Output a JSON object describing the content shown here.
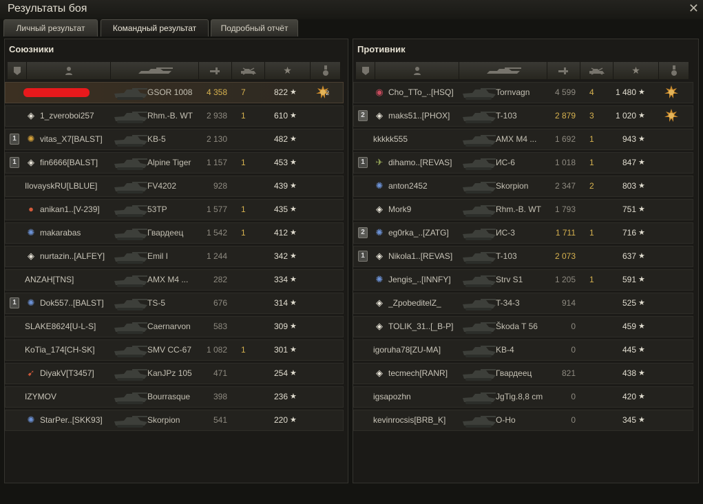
{
  "window": {
    "title": "Результаты боя",
    "close_glyph": "✕"
  },
  "tabs": [
    {
      "label": "Личный результат",
      "active": false
    },
    {
      "label": "Командный результат",
      "active": true
    },
    {
      "label": "Подробный отчёт",
      "active": false
    }
  ],
  "colors": {
    "damage_highlight": "#d7b24f",
    "self_row": "#3c3022",
    "redacted": "#e8191c"
  },
  "star_glyph": "★",
  "allies": {
    "title": "Союзники",
    "columns": [
      "platoon",
      "player",
      "tank",
      "damage",
      "kills",
      "xp",
      "medal"
    ],
    "rows": [
      {
        "squad": "",
        "badge": "",
        "badge_type": "",
        "player": "",
        "redacted": true,
        "tank": "GSOR 1008",
        "damage": "4 358",
        "damage_hi": true,
        "kills": "7",
        "xp": "822",
        "medal": "ace-medal",
        "medal_count": "2",
        "self": true
      },
      {
        "squad": "",
        "badge": "◈",
        "badge_type": "diamond",
        "player": "1_zveroboi257",
        "tank": "Rhm.-B. WT",
        "damage": "2 938",
        "damage_hi": false,
        "kills": "1",
        "xp": "610",
        "medal": ""
      },
      {
        "squad": "1",
        "badge": "✺",
        "badge_type": "gold",
        "player": "vitas_X7[BALST]",
        "tank": "KB-5",
        "damage": "2 130",
        "damage_hi": false,
        "kills": "",
        "xp": "482",
        "medal": ""
      },
      {
        "squad": "1",
        "badge": "◈",
        "badge_type": "diamond",
        "player": "fin6666[BALST]",
        "tank": "Alpine Tiger",
        "damage": "1 157",
        "damage_hi": false,
        "kills": "1",
        "xp": "453",
        "medal": ""
      },
      {
        "squad": "",
        "badge": "",
        "badge_type": "",
        "player": "IlovayskRU[LBLUE]",
        "tank": "FV4202",
        "damage": "928",
        "damage_hi": false,
        "kills": "",
        "xp": "439",
        "medal": ""
      },
      {
        "squad": "",
        "badge": "●",
        "badge_type": "red",
        "player": "anikan1..[V-239]",
        "tank": "53TP",
        "damage": "1 577",
        "damage_hi": false,
        "kills": "1",
        "xp": "435",
        "medal": ""
      },
      {
        "squad": "",
        "badge": "✺",
        "badge_type": "blue",
        "player": "makarabas",
        "tank": "Гвардеец",
        "damage": "1 542",
        "damage_hi": false,
        "kills": "1",
        "xp": "412",
        "medal": ""
      },
      {
        "squad": "",
        "badge": "◈",
        "badge_type": "diamond",
        "player": "nurtazin..[ALFEY]",
        "tank": "Emil I",
        "damage": "1 244",
        "damage_hi": false,
        "kills": "",
        "xp": "342",
        "medal": ""
      },
      {
        "squad": "",
        "badge": "",
        "badge_type": "",
        "player": "ANZAH[TNS]",
        "tank": "AMX M4 ...",
        "damage": "282",
        "damage_hi": false,
        "kills": "",
        "xp": "334",
        "medal": ""
      },
      {
        "squad": "1",
        "badge": "✺",
        "badge_type": "blue",
        "player": "Dok557..[BALST]",
        "tank": "TS-5",
        "damage": "676",
        "damage_hi": false,
        "kills": "",
        "xp": "314",
        "medal": ""
      },
      {
        "squad": "",
        "badge": "",
        "badge_type": "",
        "player": "SLAKE8624[U-L-S]",
        "tank": "Caernarvon",
        "damage": "583",
        "damage_hi": false,
        "kills": "",
        "xp": "309",
        "medal": ""
      },
      {
        "squad": "",
        "badge": "",
        "badge_type": "",
        "player": "KoTia_174[CH-SK]",
        "tank": "SMV CC-67",
        "damage": "1 082",
        "damage_hi": false,
        "kills": "1",
        "xp": "301",
        "medal": ""
      },
      {
        "squad": "",
        "badge": "➹",
        "badge_type": "red",
        "player": "DiyakV[T3457]",
        "tank": "KanJPz 105",
        "damage": "471",
        "damage_hi": false,
        "kills": "",
        "xp": "254",
        "medal": ""
      },
      {
        "squad": "",
        "badge": "",
        "badge_type": "",
        "player": "IZYMOV",
        "tank": "Bourrasque",
        "damage": "398",
        "damage_hi": false,
        "kills": "",
        "xp": "236",
        "medal": ""
      },
      {
        "squad": "",
        "badge": "✺",
        "badge_type": "blue",
        "player": "StarPer..[SKK93]",
        "tank": "Skorpion",
        "damage": "541",
        "damage_hi": false,
        "kills": "",
        "xp": "220",
        "medal": ""
      }
    ]
  },
  "enemies": {
    "title": "Противник",
    "columns": [
      "platoon",
      "player",
      "tank",
      "damage",
      "kills",
      "xp",
      "medal"
    ],
    "rows": [
      {
        "squad": "",
        "badge": "◉",
        "badge_type": "pink",
        "player": "Cho_TTo_..[HSQ]",
        "tank": "Tornvagn",
        "damage": "4 599",
        "damage_hi": false,
        "kills": "4",
        "xp": "1 480",
        "medal": "ace-medal"
      },
      {
        "squad": "2",
        "badge": "◈",
        "badge_type": "diamond",
        "player": "maks51..[PHOX]",
        "tank": "T-103",
        "damage": "2 879",
        "damage_hi": true,
        "kills": "3",
        "xp": "1 020",
        "medal": "ace-medal"
      },
      {
        "squad": "",
        "badge": "",
        "badge_type": "",
        "player": "kkkkk555",
        "tank": "AMX M4 ...",
        "damage": "1 692",
        "damage_hi": false,
        "kills": "1",
        "xp": "943",
        "medal": ""
      },
      {
        "squad": "1",
        "badge": "✈",
        "badge_type": "green",
        "player": "dihamo..[REVAS]",
        "tank": "ИС-6",
        "damage": "1 018",
        "damage_hi": false,
        "kills": "1",
        "xp": "847",
        "medal": ""
      },
      {
        "squad": "",
        "badge": "✺",
        "badge_type": "blue",
        "player": "anton2452",
        "tank": "Skorpion",
        "damage": "2 347",
        "damage_hi": false,
        "kills": "2",
        "xp": "803",
        "medal": ""
      },
      {
        "squad": "",
        "badge": "◈",
        "badge_type": "diamond",
        "player": "Mork9",
        "tank": "Rhm.-B. WT",
        "damage": "1 793",
        "damage_hi": false,
        "kills": "",
        "xp": "751",
        "medal": ""
      },
      {
        "squad": "2",
        "badge": "✺",
        "badge_type": "blue",
        "player": "eg0rka_..[ZATG]",
        "tank": "ИС-3",
        "damage": "1 711",
        "damage_hi": true,
        "kills": "1",
        "xp": "716",
        "medal": ""
      },
      {
        "squad": "1",
        "badge": "◈",
        "badge_type": "diamond",
        "player": "Nikola1..[REVAS]",
        "tank": "T-103",
        "damage": "2 073",
        "damage_hi": true,
        "kills": "",
        "xp": "637",
        "medal": ""
      },
      {
        "squad": "",
        "badge": "✺",
        "badge_type": "blue",
        "player": "Jengis_..[INNFY]",
        "tank": "Strv S1",
        "damage": "1 205",
        "damage_hi": false,
        "kills": "1",
        "xp": "591",
        "medal": ""
      },
      {
        "squad": "",
        "badge": "◈",
        "badge_type": "diamond",
        "player": "_ZpobeditelZ_",
        "tank": "T-34-3",
        "damage": "914",
        "damage_hi": false,
        "kills": "",
        "xp": "525",
        "medal": ""
      },
      {
        "squad": "",
        "badge": "◈",
        "badge_type": "diamond",
        "player": "TOLIK_31..[_B-P]",
        "tank": "Škoda T 56",
        "damage": "0",
        "damage_hi": false,
        "kills": "",
        "xp": "459",
        "medal": ""
      },
      {
        "squad": "",
        "badge": "",
        "badge_type": "",
        "player": "igoruha78[ZU-MA]",
        "tank": "KB-4",
        "damage": "0",
        "damage_hi": false,
        "kills": "",
        "xp": "445",
        "medal": ""
      },
      {
        "squad": "",
        "badge": "◈",
        "badge_type": "diamond",
        "player": "tecmech[RANR]",
        "tank": "Гвардеец",
        "damage": "821",
        "damage_hi": false,
        "kills": "",
        "xp": "438",
        "medal": ""
      },
      {
        "squad": "",
        "badge": "",
        "badge_type": "",
        "player": "igsapozhn",
        "tank": "JgTig.8,8 cm",
        "damage": "0",
        "damage_hi": false,
        "kills": "",
        "xp": "420",
        "medal": ""
      },
      {
        "squad": "",
        "badge": "",
        "badge_type": "",
        "player": "kevinrocsis[BRB_K]",
        "tank": "O-Ho",
        "damage": "0",
        "damage_hi": false,
        "kills": "",
        "xp": "345",
        "medal": ""
      }
    ]
  }
}
